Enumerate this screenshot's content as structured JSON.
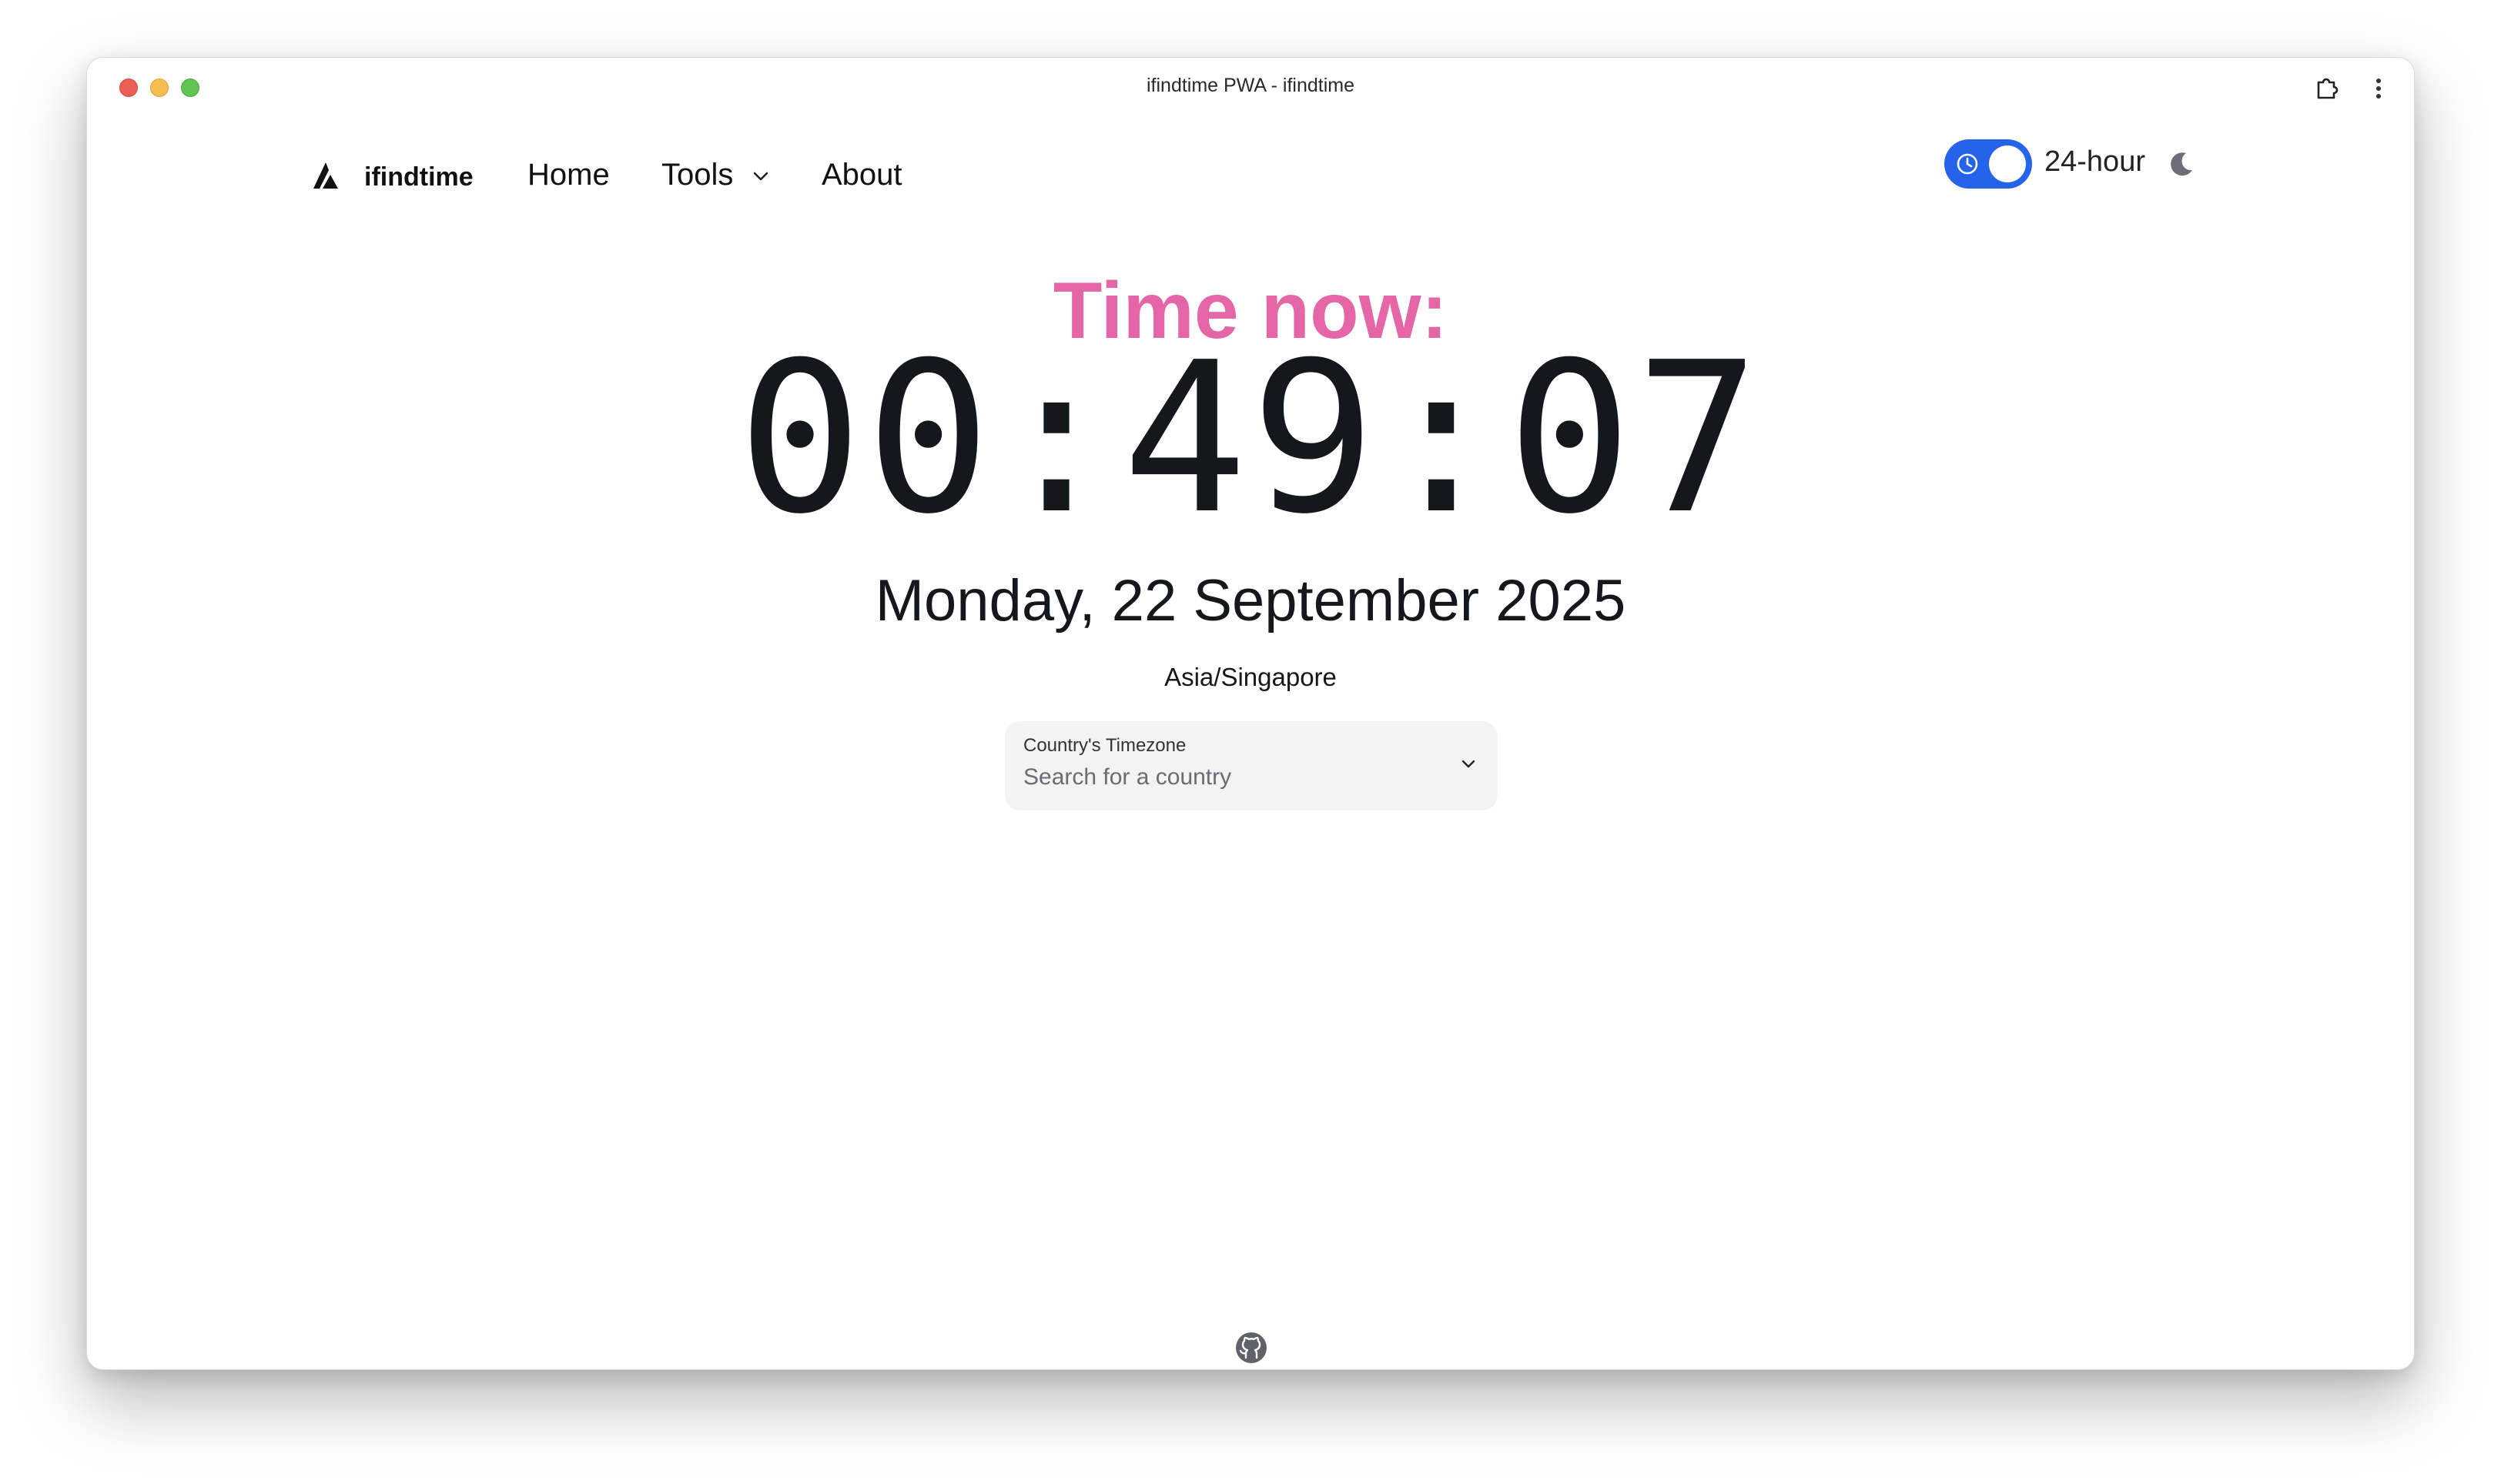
{
  "window": {
    "title": "ifindtime PWA - ifindtime"
  },
  "nav": {
    "brand": "ifindtime",
    "links": [
      "Home",
      "Tools",
      "About"
    ]
  },
  "format_toggle": {
    "label": "24-hour",
    "enabled": true
  },
  "clock": {
    "heading": "Time now:",
    "time": "00:49:07",
    "date": "Monday, 22 September 2025",
    "timezone": "Asia/Singapore"
  },
  "country_select": {
    "label": "Country's Timezone",
    "placeholder": "Search for a country"
  },
  "colors": {
    "accent": "#e466a7",
    "toggle": "#2563eb",
    "text": "#15181b"
  },
  "icons": [
    "extensions-icon",
    "more-vertical-icon",
    "logo-icon",
    "chevron-down-icon",
    "clock-icon",
    "moon-icon",
    "github-icon"
  ]
}
